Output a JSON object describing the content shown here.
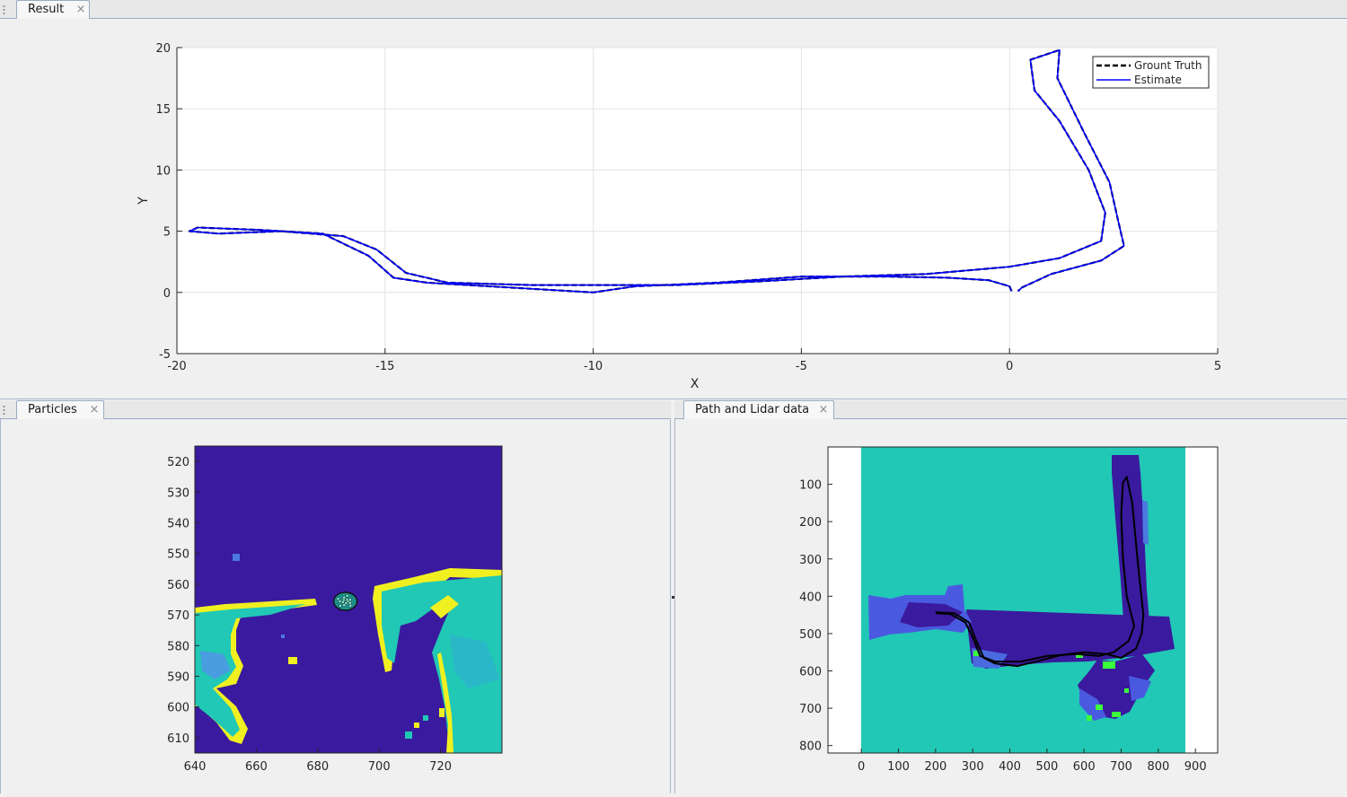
{
  "tabs": {
    "result": {
      "label": "Result",
      "close": "×"
    },
    "particles": {
      "label": "Particles",
      "close": "×"
    },
    "path_lidar": {
      "label": "Path and Lidar data",
      "close": "×"
    }
  },
  "colors": {
    "background": "#f0f0f0",
    "estimate": "#0000ff",
    "ground_truth": "#000000",
    "map_free": "#3a1a9e",
    "map_mid": "#21c8b5",
    "map_edge": "#f0f020",
    "map_green": "#3cff3c"
  },
  "chart_data": [
    {
      "id": "result",
      "type": "line",
      "xlabel": "X",
      "ylabel": "Y",
      "xlim": [
        -20,
        5
      ],
      "ylim": [
        -5,
        20
      ],
      "xticks": [
        -20,
        -15,
        -10,
        -5,
        0,
        5
      ],
      "yticks": [
        -5,
        0,
        5,
        10,
        15,
        20
      ],
      "grid": true,
      "legend": {
        "position": "top-right"
      },
      "series": [
        {
          "name": "Grount Truth",
          "style": "dashed",
          "color": "#000000",
          "points": [
            [
              0.05,
              0.1
            ],
            [
              0.0,
              0.5
            ],
            [
              -0.5,
              1.0
            ],
            [
              -1.5,
              1.2
            ],
            [
              -3.0,
              1.3
            ],
            [
              -5.0,
              1.3
            ],
            [
              -7.0,
              0.8
            ],
            [
              -9.0,
              0.5
            ],
            [
              -10.0,
              0.0
            ],
            [
              -11.0,
              0.2
            ],
            [
              -12.5,
              0.5
            ],
            [
              -14.0,
              0.8
            ],
            [
              -14.8,
              1.2
            ],
            [
              -15.4,
              3.0
            ],
            [
              -16.5,
              4.8
            ],
            [
              -18.0,
              5.1
            ],
            [
              -19.5,
              5.3
            ],
            [
              -19.7,
              5.0
            ],
            [
              -19.0,
              4.8
            ],
            [
              -17.5,
              5.0
            ],
            [
              -16.0,
              4.6
            ],
            [
              -15.2,
              3.5
            ],
            [
              -14.5,
              1.6
            ],
            [
              -13.5,
              0.8
            ],
            [
              -11.5,
              0.6
            ],
            [
              -9.5,
              0.6
            ],
            [
              -8.0,
              0.6
            ],
            [
              -6.0,
              0.9
            ],
            [
              -4.0,
              1.3
            ],
            [
              -2.0,
              1.5
            ],
            [
              0.0,
              2.1
            ],
            [
              1.2,
              2.8
            ],
            [
              2.2,
              4.2
            ],
            [
              2.3,
              6.5
            ],
            [
              1.9,
              10.0
            ],
            [
              1.2,
              14.0
            ],
            [
              0.6,
              16.5
            ],
            [
              0.5,
              19.0
            ],
            [
              1.2,
              19.8
            ],
            [
              1.15,
              17.5
            ],
            [
              1.8,
              13.0
            ],
            [
              2.4,
              9.0
            ],
            [
              2.6,
              6.0
            ],
            [
              2.75,
              3.8
            ],
            [
              2.2,
              2.6
            ],
            [
              1.0,
              1.5
            ],
            [
              0.3,
              0.4
            ],
            [
              0.2,
              0.1
            ]
          ]
        },
        {
          "name": "Estimate",
          "style": "solid",
          "color": "#0000ff",
          "points": [
            [
              0.05,
              0.1
            ],
            [
              0.0,
              0.5
            ],
            [
              -0.5,
              1.0
            ],
            [
              -1.5,
              1.2
            ],
            [
              -3.0,
              1.3
            ],
            [
              -5.0,
              1.3
            ],
            [
              -7.0,
              0.8
            ],
            [
              -9.0,
              0.5
            ],
            [
              -10.0,
              0.0
            ],
            [
              -11.0,
              0.2
            ],
            [
              -12.5,
              0.5
            ],
            [
              -14.0,
              0.8
            ],
            [
              -14.8,
              1.2
            ],
            [
              -15.4,
              3.0
            ],
            [
              -16.5,
              4.8
            ],
            [
              -18.0,
              5.1
            ],
            [
              -19.5,
              5.3
            ],
            [
              -19.7,
              5.0
            ],
            [
              -19.0,
              4.8
            ],
            [
              -17.5,
              5.0
            ],
            [
              -16.0,
              4.6
            ],
            [
              -15.2,
              3.5
            ],
            [
              -14.5,
              1.6
            ],
            [
              -13.5,
              0.8
            ],
            [
              -11.5,
              0.6
            ],
            [
              -9.5,
              0.6
            ],
            [
              -8.0,
              0.6
            ],
            [
              -6.0,
              0.9
            ],
            [
              -4.0,
              1.3
            ],
            [
              -2.0,
              1.5
            ],
            [
              0.0,
              2.1
            ],
            [
              1.2,
              2.8
            ],
            [
              2.2,
              4.2
            ],
            [
              2.3,
              6.5
            ],
            [
              1.9,
              10.0
            ],
            [
              1.2,
              14.0
            ],
            [
              0.6,
              16.5
            ],
            [
              0.5,
              19.0
            ],
            [
              1.2,
              19.8
            ],
            [
              1.15,
              17.5
            ],
            [
              1.8,
              13.0
            ],
            [
              2.4,
              9.0
            ],
            [
              2.6,
              6.0
            ],
            [
              2.75,
              3.8
            ],
            [
              2.2,
              2.6
            ],
            [
              1.0,
              1.5
            ],
            [
              0.3,
              0.4
            ],
            [
              0.2,
              0.1
            ]
          ]
        }
      ]
    },
    {
      "id": "particles",
      "type": "heatmap",
      "xlim": [
        640,
        740
      ],
      "ylim": [
        515,
        615
      ],
      "y_reversed": true,
      "xticks": [
        640,
        660,
        680,
        700,
        720
      ],
      "yticks": [
        520,
        530,
        540,
        550,
        560,
        570,
        580,
        590,
        600,
        610
      ],
      "particle_cluster": {
        "x": 689,
        "y": 565
      }
    },
    {
      "id": "path_lidar",
      "type": "heatmap",
      "xlim": [
        -90,
        960
      ],
      "ylim": [
        0,
        820
      ],
      "y_reversed": true,
      "xticks": [
        0,
        100,
        200,
        300,
        400,
        500,
        600,
        700,
        800,
        900
      ],
      "yticks": [
        100,
        200,
        300,
        400,
        500,
        600,
        700,
        800
      ],
      "map_extent_x": [
        0,
        870
      ],
      "path": [
        [
          200,
          443
        ],
        [
          250,
          445
        ],
        [
          290,
          470
        ],
        [
          310,
          520
        ],
        [
          330,
          565
        ],
        [
          360,
          580
        ],
        [
          420,
          587
        ],
        [
          470,
          575
        ],
        [
          540,
          557
        ],
        [
          600,
          550
        ],
        [
          660,
          555
        ],
        [
          700,
          565
        ],
        [
          740,
          540
        ],
        [
          755,
          500
        ],
        [
          760,
          450
        ],
        [
          750,
          360
        ],
        [
          740,
          260
        ],
        [
          730,
          150
        ],
        [
          715,
          80
        ],
        [
          705,
          95
        ],
        [
          700,
          180
        ],
        [
          705,
          300
        ],
        [
          715,
          400
        ],
        [
          735,
          480
        ],
        [
          720,
          520
        ],
        [
          680,
          550
        ],
        [
          640,
          560
        ],
        [
          580,
          555
        ],
        [
          500,
          560
        ],
        [
          430,
          575
        ],
        [
          360,
          575
        ],
        [
          320,
          560
        ],
        [
          300,
          510
        ],
        [
          280,
          470
        ],
        [
          240,
          448
        ],
        [
          200,
          445
        ]
      ]
    }
  ]
}
